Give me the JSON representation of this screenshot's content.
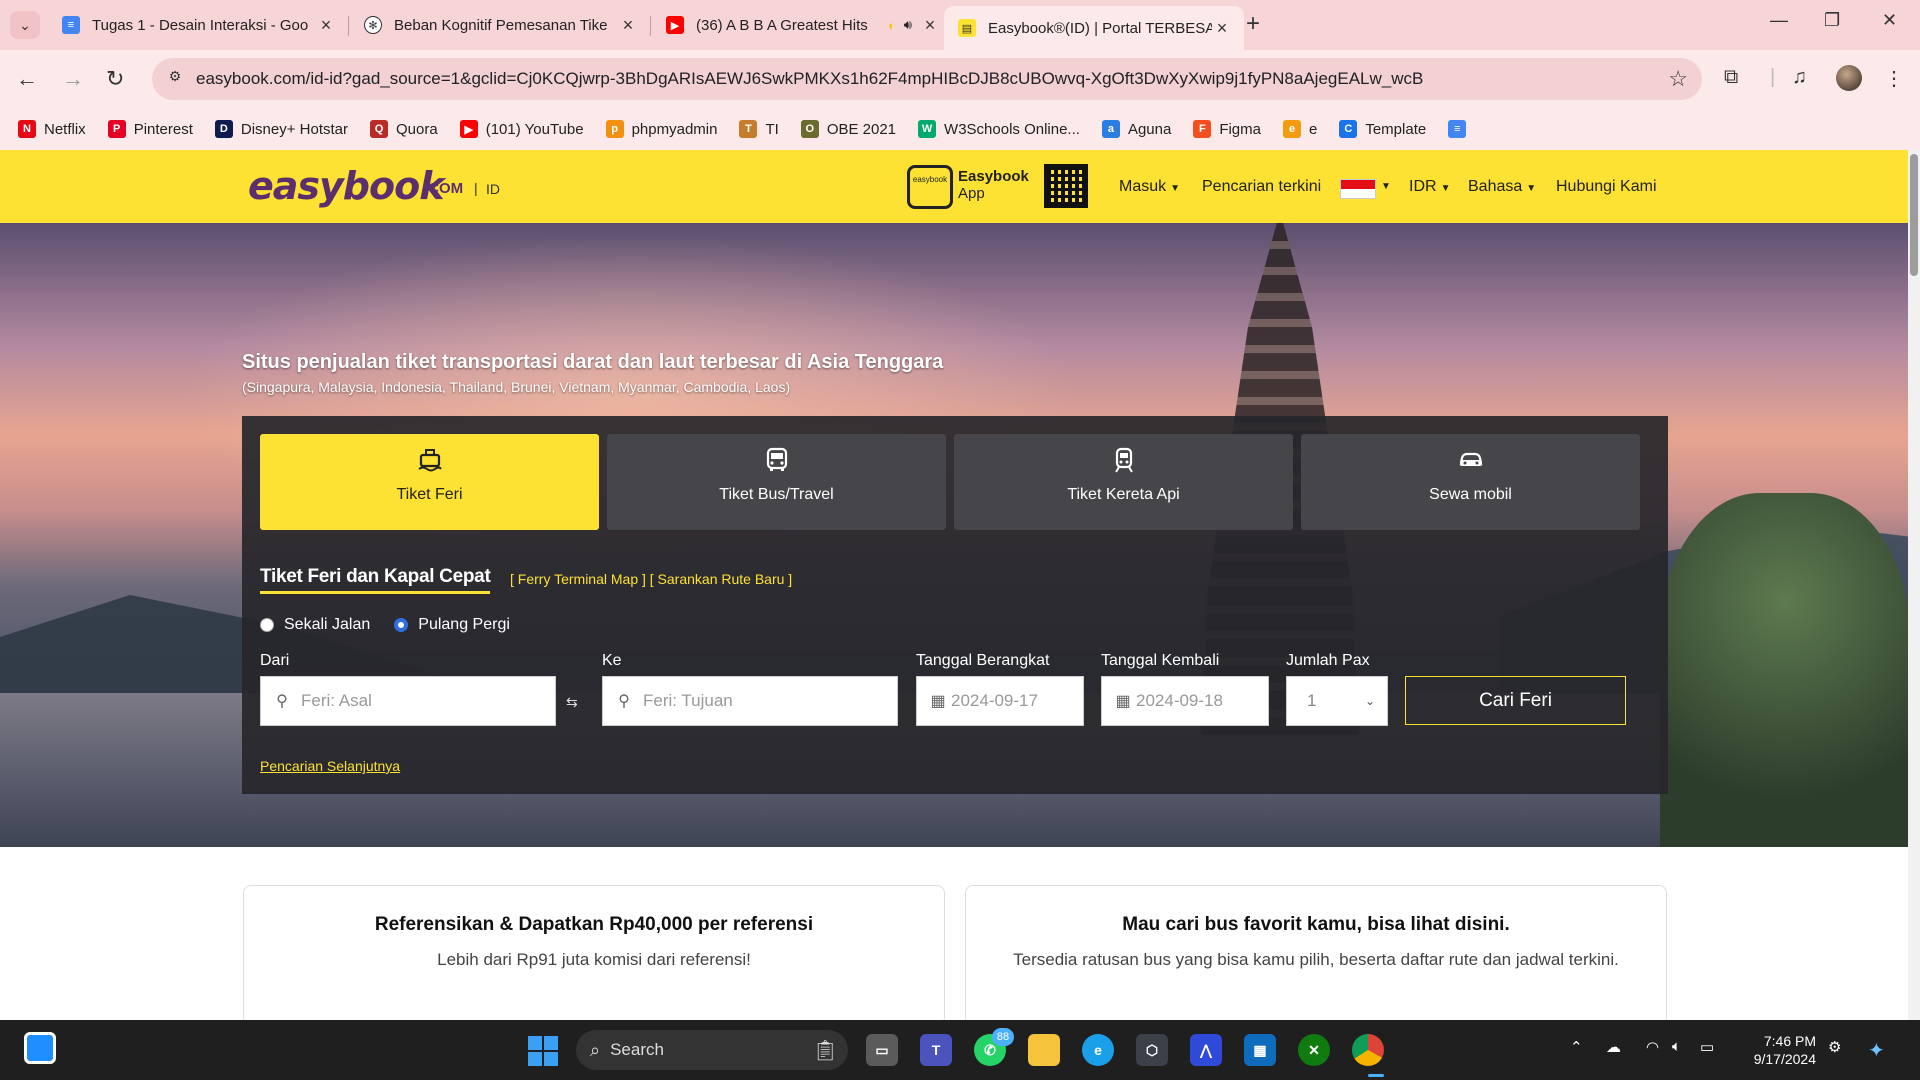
{
  "browser": {
    "tabs": [
      {
        "title": "Tugas 1 - Desain Interaksi - Goo",
        "icon": "docs-icon",
        "color": "#4285f4"
      },
      {
        "title": "Beban Kognitif Pemesanan Tike",
        "icon": "chatgpt-icon",
        "color": "#333333"
      },
      {
        "title": "(36) A B B A Greatest Hits",
        "icon": "youtube-icon",
        "color": "#ff0000"
      },
      {
        "title": "Easybook®(ID) | Portal TERBESA",
        "icon": "easybook-icon",
        "color": "#fde233"
      }
    ],
    "url": "easybook.com/id-id?gad_source=1&gclid=Cj0KCQjwrp-3BhDgARIsAEWJ6SwkPMKXs1h62F4mpHIBcDJB8cUBOwvq-XgOft3DwXyXwip9j1fyPN8aAjegEALw_wcB",
    "bookmarks": [
      {
        "label": "Netflix",
        "color": "#e50914",
        "glyph": "N"
      },
      {
        "label": "Pinterest",
        "color": "#e60023",
        "glyph": "P"
      },
      {
        "label": "Disney+ Hotstar",
        "color": "#0e1b4d",
        "glyph": "D"
      },
      {
        "label": "Quora",
        "color": "#b92b27",
        "glyph": "Q"
      },
      {
        "label": "(101) YouTube",
        "color": "#ff0000",
        "glyph": "▶"
      },
      {
        "label": "phpmyadmin",
        "color": "#f29111",
        "glyph": "p"
      },
      {
        "label": "TI",
        "color": "#c77b2c",
        "glyph": "T"
      },
      {
        "label": "OBE 2021",
        "color": "#6b6b2c",
        "glyph": "O"
      },
      {
        "label": "W3Schools Online...",
        "color": "#04aa6d",
        "glyph": "W"
      },
      {
        "label": "Aguna",
        "color": "#2a7de1",
        "glyph": "a"
      },
      {
        "label": "Figma",
        "color": "#f24e1e",
        "glyph": "F"
      },
      {
        "label": "e",
        "color": "#f39c12",
        "glyph": "e"
      },
      {
        "label": "Template",
        "color": "#1a73e8",
        "glyph": "C"
      },
      {
        "label": "",
        "color": "#4285f4",
        "glyph": "≡"
      }
    ]
  },
  "site": {
    "logo": "easybook",
    "logo_com": ".COM",
    "logo_sep": "|",
    "logo_country": "ID",
    "app_badge": "easybook",
    "app_title": "Easybook",
    "app_sub": "App",
    "nav": {
      "login": "Masuk",
      "recent": "Pencarian terkini",
      "currency": "IDR",
      "language": "Bahasa",
      "contact": "Hubungi Kami"
    }
  },
  "hero": {
    "title": "Situs penjualan tiket transportasi darat dan laut terbesar di Asia Tenggara",
    "subtitle": "(Singapura, Malaysia, Indonesia, Thailand, Brunei, Vietnam, Myanmar, Cambodia, Laos)"
  },
  "search": {
    "tabs": [
      {
        "label": "Tiket Feri",
        "icon": "ferry-icon"
      },
      {
        "label": "Tiket Bus/Travel",
        "icon": "bus-icon"
      },
      {
        "label": "Tiket Kereta Api",
        "icon": "train-icon"
      },
      {
        "label": "Sewa mobil",
        "icon": "car-icon"
      }
    ],
    "form_title": "Tiket Feri dan Kapal Cepat",
    "links": "[ Ferry Terminal Map ] [ Sarankan Rute Baru ]",
    "trip_one_way": "Sekali Jalan",
    "trip_return": "Pulang Pergi",
    "selected_trip": "Pulang Pergi",
    "from_label": "Dari",
    "from_placeholder": "Feri: Asal",
    "to_label": "Ke",
    "to_placeholder": "Feri: Tujuan",
    "depart_label": "Tanggal Berangkat",
    "depart_value": "2024-09-17",
    "return_label": "Tanggal Kembali",
    "return_value": "2024-09-18",
    "pax_label": "Jumlah Pax",
    "pax_value": "1",
    "submit": "Cari Feri",
    "next_search": "Pencarian Selanjutnya"
  },
  "promos": [
    {
      "title": "Referensikan & Dapatkan Rp40,000 per referensi",
      "text": "Lebih dari Rp91 juta komisi dari referensi!"
    },
    {
      "title": "Mau cari bus favorit kamu, bisa lihat disini.",
      "text": "Tersedia ratusan bus yang bisa kamu pilih, beserta daftar rute dan jadwal terkini."
    }
  ],
  "taskbar": {
    "search": "Search",
    "whatsapp_badge": "88",
    "time": "7:46 PM",
    "date": "9/17/2024"
  }
}
